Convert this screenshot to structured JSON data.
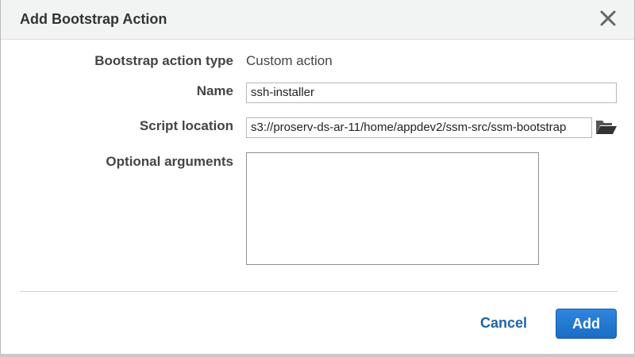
{
  "dialog": {
    "title": "Add Bootstrap Action",
    "close_icon": "close-icon"
  },
  "form": {
    "action_type_label": "Bootstrap action type",
    "action_type_value": "Custom action",
    "name_label": "Name",
    "name_value": "ssh-installer",
    "script_location_label": "Script location",
    "script_location_value": "s3://proserv-ds-ar-11/home/appdev2/ssm-src/ssm-bootstrap",
    "script_browse_icon": "folder-open-icon",
    "optional_arguments_label": "Optional arguments",
    "optional_arguments_value": ""
  },
  "footer": {
    "cancel_label": "Cancel",
    "add_label": "Add"
  },
  "colors": {
    "primary_button": "#1b6cc4",
    "link": "#1f63a5",
    "header_bg": "#f2f3f3"
  }
}
